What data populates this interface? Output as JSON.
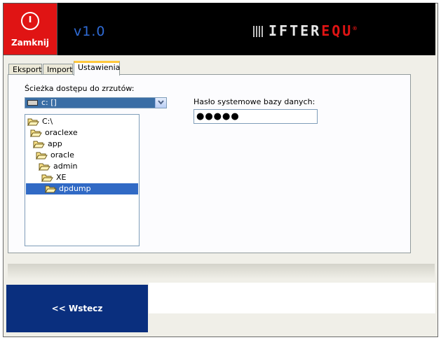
{
  "header": {
    "close_label": "Zamknij",
    "version": "v1.0",
    "logo_part_white": "IFTER",
    "logo_part_red": "EQU",
    "logo_mark": "®"
  },
  "tabs": [
    {
      "label": "Eksport",
      "active": false
    },
    {
      "label": "Import",
      "active": false
    },
    {
      "label": "Ustawienia",
      "active": true
    }
  ],
  "settings": {
    "path_label": "Ścieżka dostępu do zrzutów:",
    "drive_value": "c: []",
    "tree": [
      {
        "label": "C:\\",
        "level": 0,
        "selected": false
      },
      {
        "label": "oraclexe",
        "level": 1,
        "selected": false
      },
      {
        "label": "app",
        "level": 2,
        "selected": false
      },
      {
        "label": "oracle",
        "level": 3,
        "selected": false
      },
      {
        "label": "admin",
        "level": 4,
        "selected": false
      },
      {
        "label": "XE",
        "level": 5,
        "selected": false
      },
      {
        "label": "dpdump",
        "level": 6,
        "selected": true
      }
    ],
    "password_label": "Hasło systemowe bazy danych:",
    "password_value": "●●●●●"
  },
  "footer": {
    "back_label": "<< Wstecz"
  },
  "colors": {
    "close_bg": "#e01414",
    "header_bg": "#000000",
    "accent_blue": "#2f6bd6",
    "selection": "#316ac5",
    "back_bg": "#0a2f7e"
  }
}
